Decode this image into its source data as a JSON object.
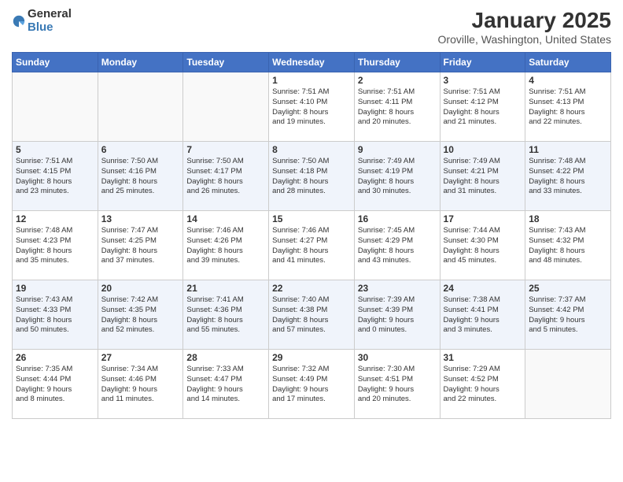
{
  "header": {
    "logo_general": "General",
    "logo_blue": "Blue",
    "title": "January 2025",
    "location": "Oroville, Washington, United States"
  },
  "days_of_week": [
    "Sunday",
    "Monday",
    "Tuesday",
    "Wednesday",
    "Thursday",
    "Friday",
    "Saturday"
  ],
  "weeks": [
    [
      {
        "day": "",
        "info": ""
      },
      {
        "day": "",
        "info": ""
      },
      {
        "day": "",
        "info": ""
      },
      {
        "day": "1",
        "info": "Sunrise: 7:51 AM\nSunset: 4:10 PM\nDaylight: 8 hours\nand 19 minutes."
      },
      {
        "day": "2",
        "info": "Sunrise: 7:51 AM\nSunset: 4:11 PM\nDaylight: 8 hours\nand 20 minutes."
      },
      {
        "day": "3",
        "info": "Sunrise: 7:51 AM\nSunset: 4:12 PM\nDaylight: 8 hours\nand 21 minutes."
      },
      {
        "day": "4",
        "info": "Sunrise: 7:51 AM\nSunset: 4:13 PM\nDaylight: 8 hours\nand 22 minutes."
      }
    ],
    [
      {
        "day": "5",
        "info": "Sunrise: 7:51 AM\nSunset: 4:15 PM\nDaylight: 8 hours\nand 23 minutes."
      },
      {
        "day": "6",
        "info": "Sunrise: 7:50 AM\nSunset: 4:16 PM\nDaylight: 8 hours\nand 25 minutes."
      },
      {
        "day": "7",
        "info": "Sunrise: 7:50 AM\nSunset: 4:17 PM\nDaylight: 8 hours\nand 26 minutes."
      },
      {
        "day": "8",
        "info": "Sunrise: 7:50 AM\nSunset: 4:18 PM\nDaylight: 8 hours\nand 28 minutes."
      },
      {
        "day": "9",
        "info": "Sunrise: 7:49 AM\nSunset: 4:19 PM\nDaylight: 8 hours\nand 30 minutes."
      },
      {
        "day": "10",
        "info": "Sunrise: 7:49 AM\nSunset: 4:21 PM\nDaylight: 8 hours\nand 31 minutes."
      },
      {
        "day": "11",
        "info": "Sunrise: 7:48 AM\nSunset: 4:22 PM\nDaylight: 8 hours\nand 33 minutes."
      }
    ],
    [
      {
        "day": "12",
        "info": "Sunrise: 7:48 AM\nSunset: 4:23 PM\nDaylight: 8 hours\nand 35 minutes."
      },
      {
        "day": "13",
        "info": "Sunrise: 7:47 AM\nSunset: 4:25 PM\nDaylight: 8 hours\nand 37 minutes."
      },
      {
        "day": "14",
        "info": "Sunrise: 7:46 AM\nSunset: 4:26 PM\nDaylight: 8 hours\nand 39 minutes."
      },
      {
        "day": "15",
        "info": "Sunrise: 7:46 AM\nSunset: 4:27 PM\nDaylight: 8 hours\nand 41 minutes."
      },
      {
        "day": "16",
        "info": "Sunrise: 7:45 AM\nSunset: 4:29 PM\nDaylight: 8 hours\nand 43 minutes."
      },
      {
        "day": "17",
        "info": "Sunrise: 7:44 AM\nSunset: 4:30 PM\nDaylight: 8 hours\nand 45 minutes."
      },
      {
        "day": "18",
        "info": "Sunrise: 7:43 AM\nSunset: 4:32 PM\nDaylight: 8 hours\nand 48 minutes."
      }
    ],
    [
      {
        "day": "19",
        "info": "Sunrise: 7:43 AM\nSunset: 4:33 PM\nDaylight: 8 hours\nand 50 minutes."
      },
      {
        "day": "20",
        "info": "Sunrise: 7:42 AM\nSunset: 4:35 PM\nDaylight: 8 hours\nand 52 minutes."
      },
      {
        "day": "21",
        "info": "Sunrise: 7:41 AM\nSunset: 4:36 PM\nDaylight: 8 hours\nand 55 minutes."
      },
      {
        "day": "22",
        "info": "Sunrise: 7:40 AM\nSunset: 4:38 PM\nDaylight: 8 hours\nand 57 minutes."
      },
      {
        "day": "23",
        "info": "Sunrise: 7:39 AM\nSunset: 4:39 PM\nDaylight: 9 hours\nand 0 minutes."
      },
      {
        "day": "24",
        "info": "Sunrise: 7:38 AM\nSunset: 4:41 PM\nDaylight: 9 hours\nand 3 minutes."
      },
      {
        "day": "25",
        "info": "Sunrise: 7:37 AM\nSunset: 4:42 PM\nDaylight: 9 hours\nand 5 minutes."
      }
    ],
    [
      {
        "day": "26",
        "info": "Sunrise: 7:35 AM\nSunset: 4:44 PM\nDaylight: 9 hours\nand 8 minutes."
      },
      {
        "day": "27",
        "info": "Sunrise: 7:34 AM\nSunset: 4:46 PM\nDaylight: 9 hours\nand 11 minutes."
      },
      {
        "day": "28",
        "info": "Sunrise: 7:33 AM\nSunset: 4:47 PM\nDaylight: 9 hours\nand 14 minutes."
      },
      {
        "day": "29",
        "info": "Sunrise: 7:32 AM\nSunset: 4:49 PM\nDaylight: 9 hours\nand 17 minutes."
      },
      {
        "day": "30",
        "info": "Sunrise: 7:30 AM\nSunset: 4:51 PM\nDaylight: 9 hours\nand 20 minutes."
      },
      {
        "day": "31",
        "info": "Sunrise: 7:29 AM\nSunset: 4:52 PM\nDaylight: 9 hours\nand 22 minutes."
      },
      {
        "day": "",
        "info": ""
      }
    ]
  ]
}
